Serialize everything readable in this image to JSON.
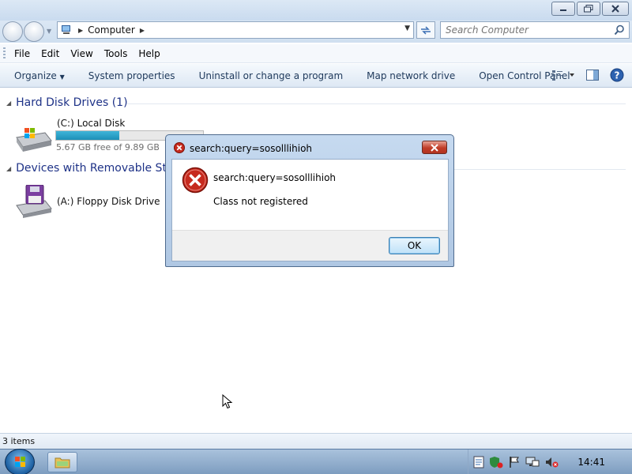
{
  "window": {
    "address_crumb": "Computer",
    "search_placeholder": "Search Computer"
  },
  "menu": [
    "File",
    "Edit",
    "View",
    "Tools",
    "Help"
  ],
  "commands": [
    "Organize",
    "System properties",
    "Uninstall or change a program",
    "Map network drive",
    "Open Control Panel"
  ],
  "groups": {
    "hard_disks": {
      "title": "Hard Disk Drives (1)",
      "drives": [
        {
          "name": "(C:) Local Disk",
          "free_text": "5.67 GB free of 9.89 GB",
          "used_fraction": 0.43
        }
      ]
    },
    "removable": {
      "title": "Devices with Removable Storage (2)",
      "drives": [
        {
          "name": "(A:) Floppy Disk Drive"
        }
      ]
    }
  },
  "status": {
    "items": "3 items"
  },
  "taskbar": {
    "clock": "14:41"
  },
  "dialog": {
    "title": "search:query=sosolllihioh",
    "message": "search:query=sosolllihioh",
    "detail": "Class not registered",
    "ok_label": "OK"
  },
  "colors": {
    "accent": "#1e3287",
    "bar_fill": "#1d8fb7",
    "error_red": "#c62a1e"
  }
}
